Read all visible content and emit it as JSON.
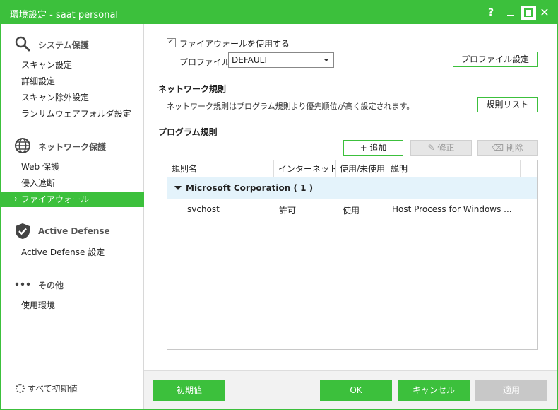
{
  "window": {
    "title": "環境設定 - saat personal",
    "help": "?",
    "close": "✕"
  },
  "sidebar": {
    "sections": [
      {
        "label": "システム保護",
        "icon": "search-icon"
      },
      {
        "label": "ネットワーク保護",
        "icon": "globe-icon"
      },
      {
        "label": "Active Defense",
        "icon": "shield-icon"
      },
      {
        "label": "その他",
        "icon": "more-icon"
      }
    ],
    "items": [
      "スキャン設定",
      "詳細設定",
      "スキャン除外設定",
      "ランサムウェアフォルダ設定",
      "Web 保護",
      "侵入遮断",
      "ファイアウォール",
      "Active Defense 設定",
      "使用環境"
    ],
    "active_item": "ファイアウォール",
    "reset_all": "すべて初期値"
  },
  "main": {
    "use_firewall_label": "ファイアウォールを使用する",
    "use_firewall_checked": true,
    "profile_label": "プロファイル:",
    "profile_value": "DEFAULT",
    "profile_settings_button": "プロファイル設定",
    "network_rules_title": "ネットワーク規則",
    "network_rules_note": "ネットワーク規則はプログラム規則より優先順位が高く設定されます。",
    "rule_list_button": "規則リスト",
    "program_rules_title": "プログラム規則",
    "add_button": "+ 追加",
    "edit_button": "修正",
    "delete_button": "削除",
    "table": {
      "columns": [
        "規則名",
        "インターネット接続",
        "使用/未使用",
        "説明"
      ],
      "group": "Microsoft Corporation ( 1 )",
      "rows": [
        {
          "name": "svchost",
          "internet": "許可",
          "use": "使用",
          "description": "Host Process for Windows ..."
        }
      ]
    }
  },
  "footer": {
    "default_button": "初期値",
    "ok_button": "OK",
    "cancel_button": "キャンセル",
    "apply_button": "適用"
  },
  "colors": {
    "accent": "#3cc03c",
    "group_row": "#e4f3fb"
  }
}
